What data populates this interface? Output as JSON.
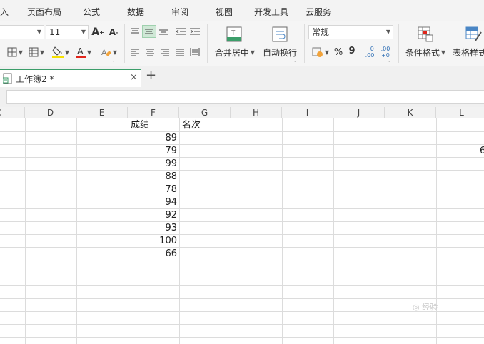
{
  "menu": [
    "入",
    "页面布局",
    "公式",
    "数据",
    "审阅",
    "视图",
    "开发工具",
    "云服务"
  ],
  "ribbon": {
    "font_name": "",
    "font_size": "11",
    "grow_font": "A",
    "shrink_font": "A",
    "merge_center": "合并居中",
    "wrap_text": "自动换行",
    "number_format": "常规",
    "percent": "%",
    "thousands": "9",
    "inc_decimal": "+0 .00",
    "dec_decimal": ".00 +0",
    "conditional_format": "条件格式",
    "table_style": "表格样式"
  },
  "tab": {
    "title": "工作簿2 *",
    "close": "×",
    "new": "+"
  },
  "columns": [
    "C",
    "D",
    "E",
    "F",
    "G",
    "H",
    "I",
    "J",
    "K",
    "L"
  ],
  "headers": {
    "F": "成绩",
    "G": "名次"
  },
  "scores": [
    "89",
    "79",
    "99",
    "88",
    "78",
    "94",
    "92",
    "93",
    "100",
    "66"
  ],
  "edge_value": "6",
  "watermark": "◎ 经验"
}
